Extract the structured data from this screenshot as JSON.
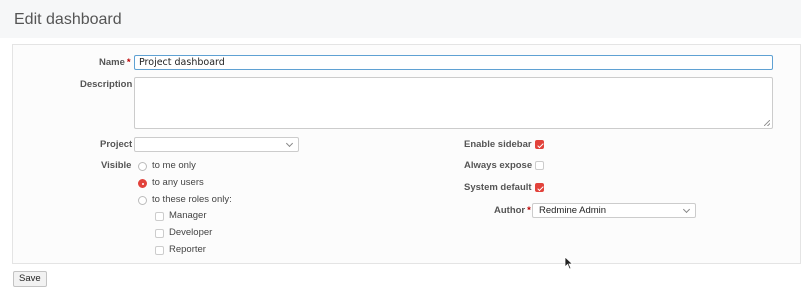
{
  "header": {
    "title": "Edit dashboard"
  },
  "form": {
    "name_label": "Name",
    "required_mark": "*",
    "name_value": "Project dashboard",
    "description_label": "Description",
    "description_value": "",
    "project_label": "Project",
    "project_value": "",
    "visible_label": "Visible",
    "visible_options": [
      "to me only",
      "to any users",
      "to these roles only:"
    ],
    "visible_selected": "to any users",
    "roles": [
      "Manager",
      "Developer",
      "Reporter"
    ],
    "enable_sidebar_label": "Enable sidebar",
    "enable_sidebar": true,
    "always_expose_label": "Always expose",
    "always_expose": false,
    "system_default_label": "System default",
    "system_default": true,
    "author_label": "Author",
    "author_value": "Redmine Admin"
  },
  "actions": {
    "save_label": "Save"
  },
  "colors": {
    "accent": "#e2423b",
    "focus_border": "#5fa1d3",
    "required": "#bb0000"
  },
  "icons": [
    "chevron-down-icon",
    "resize-grip-icon",
    "mouse-cursor-icon",
    "check-icon"
  ]
}
